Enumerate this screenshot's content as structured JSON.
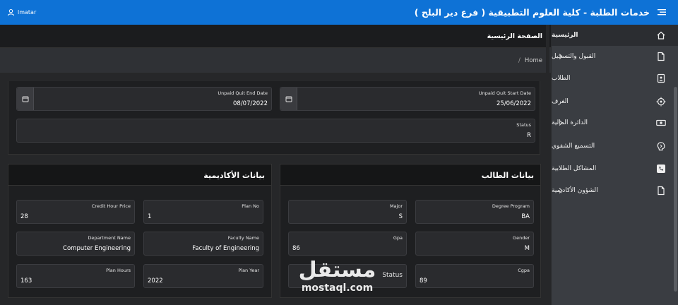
{
  "header": {
    "app_title": "خدمات الطلبة - كلية العلوم التطبيقية ( فرع دير البلح )",
    "user": "lmatar",
    "menu_icon": "hamburger-icon",
    "user_icon": "user-icon"
  },
  "sidebar": {
    "items": [
      {
        "label": "الرئيسية",
        "icon": "home-icon",
        "active": true,
        "expandable": false
      },
      {
        "label": "القبول والتسجيل",
        "icon": "document-icon",
        "active": false,
        "expandable": true
      },
      {
        "label": "الطلاب",
        "icon": "contact-card-icon",
        "active": false,
        "expandable": false
      },
      {
        "label": "الغرف",
        "icon": "target-icon",
        "active": false,
        "expandable": false
      },
      {
        "label": "الدائرة المالية",
        "icon": "money-icon",
        "active": false,
        "expandable": true
      },
      {
        "label": "التسميع الشفوي",
        "icon": "brain-icon",
        "active": false,
        "expandable": false
      },
      {
        "label": "المشاكل الطلابية",
        "icon": "phone-icon",
        "active": false,
        "expandable": false
      },
      {
        "label": "الشؤون الأكاديمية",
        "icon": "document-icon",
        "active": false,
        "expandable": true
      }
    ]
  },
  "page": {
    "title": "الصفحة الرئيسية",
    "breadcrumb": "Home",
    "breadcrumb_sep": "/"
  },
  "quit": {
    "start_label": "Unpaid Quit Start Date",
    "start_value": "25/06/2022",
    "end_label": "Unpaid Quit End Date",
    "end_value": "08/07/2022",
    "status_label": "Status",
    "status_value": "R"
  },
  "student": {
    "title": "بيانات الطالب",
    "degree_label": "Degree Program",
    "degree_value": "BA",
    "major_label": "Major",
    "major_value": "S",
    "gender_label": "Gender",
    "gender_value": "M",
    "gpa_label": "Gpa",
    "gpa_value": "86",
    "cgpa_label": "Cgpa",
    "cgpa_value": "89",
    "status_label": "Status"
  },
  "academic": {
    "title": "بيانات الأكاديمية",
    "plan_no_label": "Plan No",
    "plan_no_value": "1",
    "credit_label": "Credit Hour Price",
    "credit_value": "28",
    "faculty_label": "Faculty Name",
    "faculty_value": "Faculty of Engineering",
    "dept_label": "Department Name",
    "dept_value": "Computer Engineering",
    "plan_year_label": "Plan Year",
    "plan_year_value": "2022",
    "plan_hours_label": "Plan Hours",
    "plan_hours_value": "163"
  },
  "watermark": {
    "arabic": "مستقل",
    "latin": "mostaql.com"
  },
  "colors": {
    "accent": "#0e72d6",
    "sidebar": "#3a3d42",
    "background": "#262729"
  }
}
